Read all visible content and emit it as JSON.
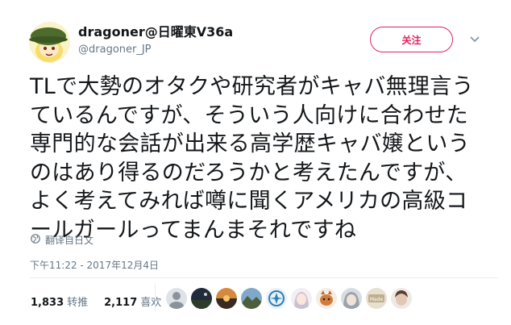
{
  "author": {
    "display_name": "dragoner@日曜東V36a",
    "handle": "@dragoner_JP"
  },
  "follow_label": "关注",
  "tweet": {
    "lines": [
      "TLで大勢のオタクや研究者がキャバ無理言う",
      "ているんですが、そういう人向けに合わせた",
      "専門的な会話が出来る高学歴キャバ嬢という",
      "のはあり得るのだろうかと考えたんですが、",
      "よく考えてみれば噂に聞くアメリカの高級コ",
      "ールガールってまんまそれですね"
    ]
  },
  "translate_label": "翻译自日文",
  "timestamp": "下午11:22 - 2017年12月4日",
  "stats": {
    "retweets_count": "1,833",
    "retweets_label": "转推",
    "likes_count": "2,117",
    "likes_label": "喜欢"
  },
  "colors": {
    "follow": "#e0245e",
    "muted": "#657786",
    "text": "#14171a"
  },
  "likers": [
    {
      "icon": "avatar-gray-figure"
    },
    {
      "icon": "avatar-dark-landscape"
    },
    {
      "icon": "avatar-sunset"
    },
    {
      "icon": "avatar-mountain"
    },
    {
      "icon": "avatar-blue-emblem"
    },
    {
      "icon": "avatar-anime-girl"
    },
    {
      "icon": "avatar-cat"
    },
    {
      "icon": "avatar-grey-hair"
    },
    {
      "icon": "avatar-sign"
    },
    {
      "icon": "avatar-portrait"
    }
  ],
  "liker_sign_text": "Made"
}
